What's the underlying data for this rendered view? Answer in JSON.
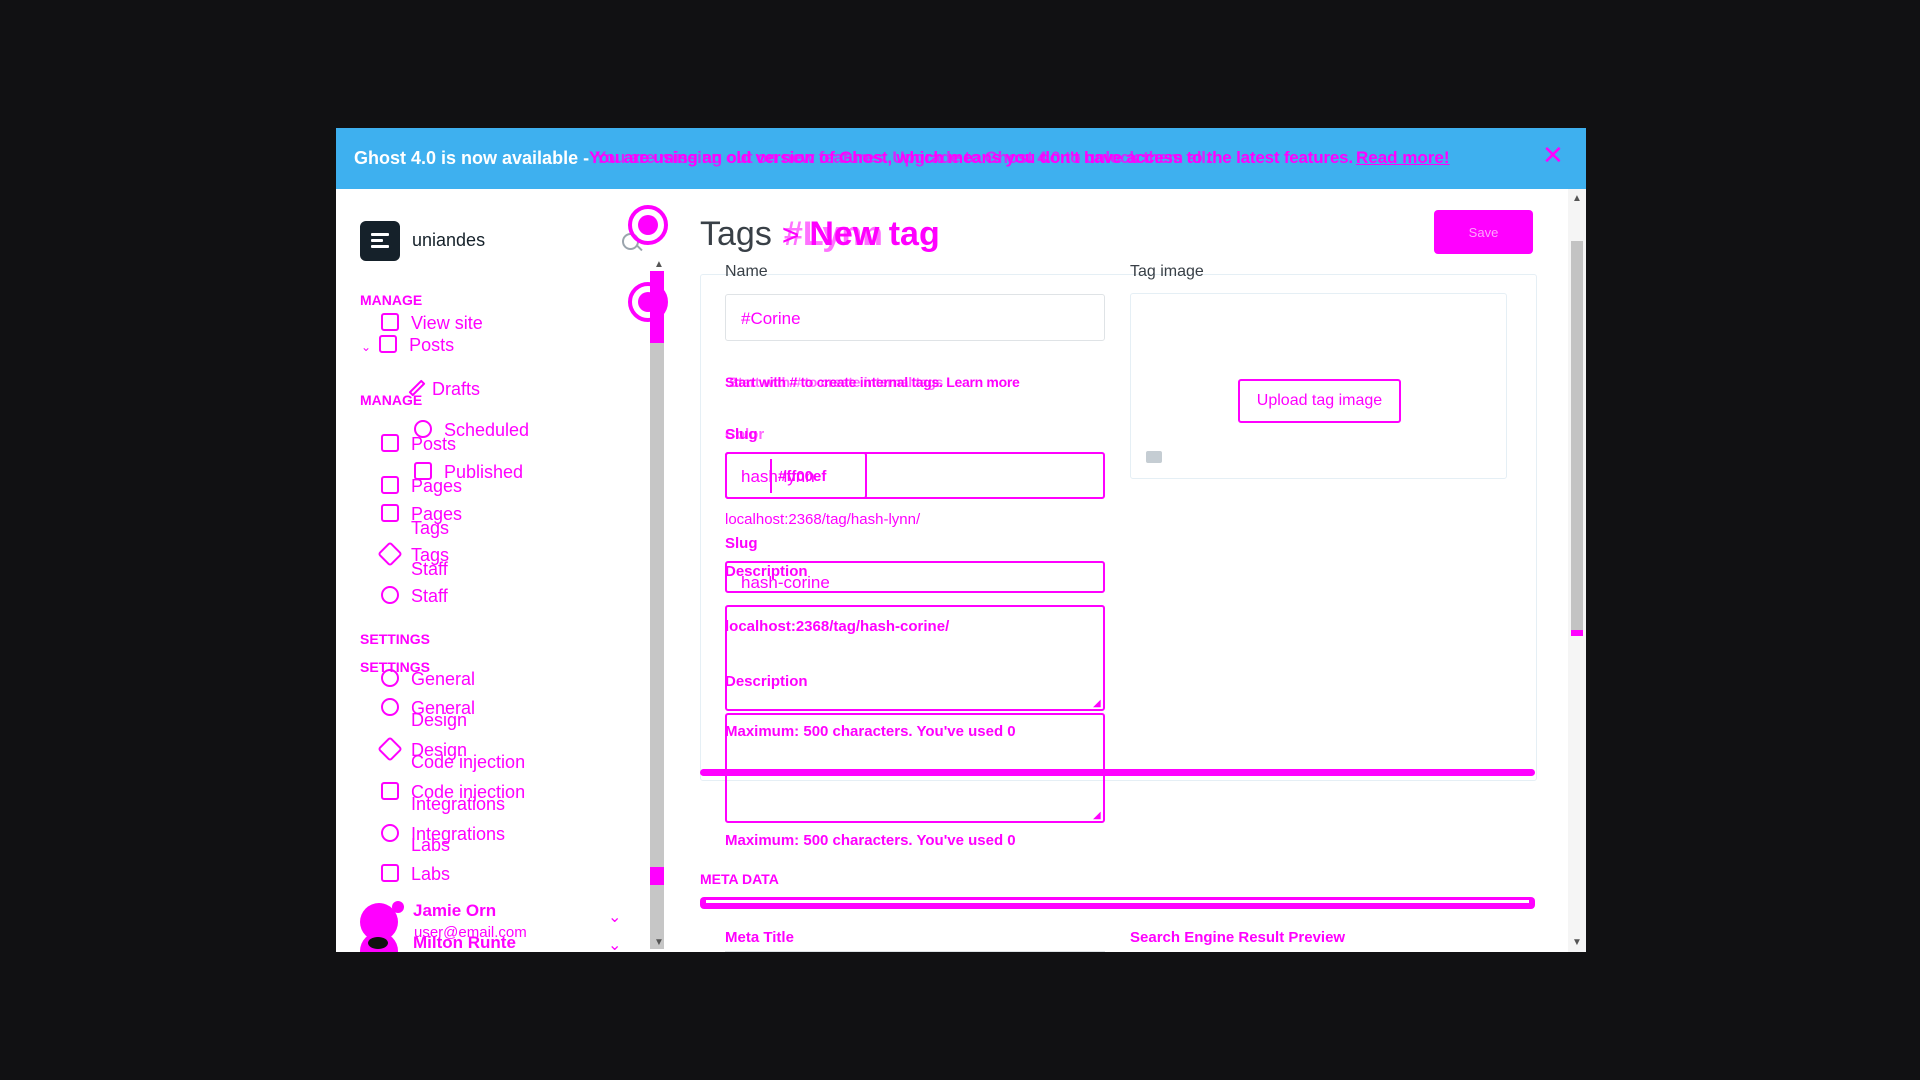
{
  "banner": {
    "lead": "Ghost 4.0 is now available -",
    "message": "You are using an old version of Ghost, which means you don't have access to the latest features.",
    "message_overlay": "You are missing out on new features. Upgrade to Ghost 4.0 to unlock them all.",
    "read_more": "Read more!"
  },
  "sidebar": {
    "brand": "uniandes",
    "manage_label": "MANAGE",
    "settings_label": "SETTINGS",
    "manage_items": [
      "View site",
      "Posts",
      "Drafts",
      "Scheduled",
      "Published",
      "Pages",
      "Tags",
      "Staff"
    ],
    "manage_items_shifted": [
      "Posts",
      "Pages",
      "Tags",
      "Staff"
    ],
    "settings_items": [
      "General",
      "Design",
      "Code injection",
      "Integrations",
      "Labs"
    ],
    "settings_items_shifted": [
      "General",
      "Design",
      "Code injection",
      "Integrations"
    ],
    "user": {
      "name": "Jamie Orn",
      "email": "user@email.com",
      "name_overlay": "Milton Runte"
    }
  },
  "main": {
    "breadcrumb_parent": "Tags",
    "breadcrumb_current": "New tag",
    "breadcrumb_current_overlay": "#Lynn",
    "save_label": "Save",
    "name_label": "Name",
    "name_value": "#Corine",
    "name_hint": "Start with # to create internal tags. Learn more",
    "name_hint_overlay": "Start with # to create internal tags",
    "slug_label": "Slug",
    "slug_label_overlay": "Color",
    "slug_value": "hash-lynn",
    "color_value": "#ff00ef",
    "slug_url": "localhost:2368/tag/hash-lynn/",
    "slug_label_2": "Slug",
    "description_label": "Description",
    "slug_value_2": "hash-corine",
    "slug_url_2": "localhost:2368/tag/hash-corine/",
    "description_label_2": "Description",
    "max_text": "Maximum: 500 characters. You've used 0",
    "tag_image_label": "Tag image",
    "upload_label": "Upload tag image",
    "meta_data_label": "META DATA",
    "meta_title_label": "Meta Title",
    "search_preview_label": "Search Engine Result Preview"
  }
}
